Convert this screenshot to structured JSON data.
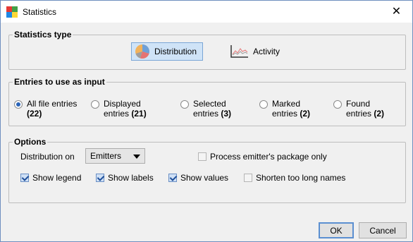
{
  "window": {
    "title": "Statistics",
    "close_glyph": "✕"
  },
  "statistics_type": {
    "legend": "Statistics type",
    "options": [
      {
        "label": "Distribution",
        "icon": "pie-chart-icon",
        "selected": true
      },
      {
        "label": "Activity",
        "icon": "line-chart-icon",
        "selected": false
      }
    ]
  },
  "entries": {
    "legend": "Entries to use as input",
    "options": [
      {
        "line1": "All file entries",
        "count": "(22)",
        "checked": true
      },
      {
        "line1": "Displayed",
        "line2": "entries",
        "count": "(21)",
        "checked": false
      },
      {
        "line1": "Selected",
        "line2": "entries",
        "count": "(3)",
        "checked": false
      },
      {
        "line1": "Marked",
        "line2": "entries",
        "count": "(2)",
        "checked": false
      },
      {
        "line1": "Found",
        "line2": "entries",
        "count": "(2)",
        "checked": false
      }
    ]
  },
  "options": {
    "legend": "Options",
    "distribution_on_label": "Distribution on",
    "distribution_on_value": "Emitters",
    "process_package_only": "Process emitter's package only",
    "show_legend": "Show legend",
    "show_labels": "Show labels",
    "show_values": "Show values",
    "shorten_names": "Shorten too long names"
  },
  "buttons": {
    "ok": "OK",
    "cancel": "Cancel"
  }
}
